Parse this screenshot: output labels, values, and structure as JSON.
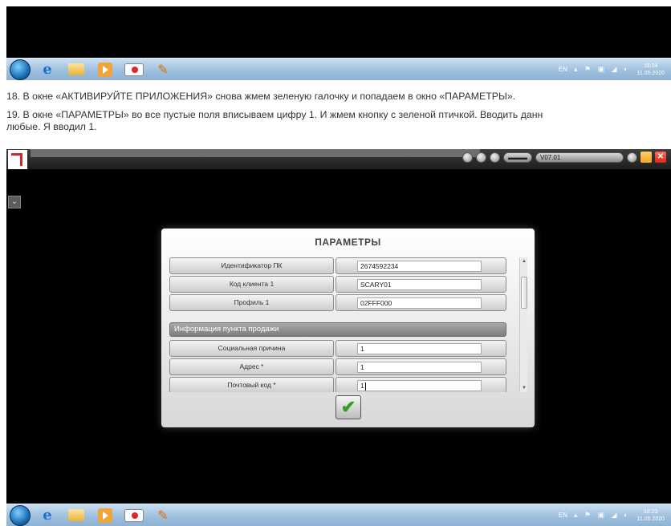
{
  "taskbar_top": {
    "tray": {
      "lang": "EN",
      "time": "18:04",
      "date": "11.05.2020"
    }
  },
  "instructions": {
    "step18": "18. В окне «АКТИВИРУЙТЕ ПРИЛОЖЕНИЯ» снова жмем зеленую галочку и попадаем в окно «ПАРАМЕТРЫ».",
    "step19_line1": "19. В окне «ПАРАМЕТРЫ» во все пустые поля вписываем цифру 1. И жмем кнопку с зеленой птичкой. Вводить данн",
    "step19_line2": "любые. Я вводил 1."
  },
  "app": {
    "version": "V07.01",
    "dialog": {
      "title": "ПАРАМЕТРЫ",
      "rows_top": [
        {
          "label": "Идентификатор ПК",
          "value": "2674592234"
        },
        {
          "label": "Код клиента 1",
          "value": "SCARY01"
        },
        {
          "label": "Профиль 1",
          "value": "02FFF000"
        }
      ],
      "section_title": "Информация пункта продажи",
      "rows_bottom": [
        {
          "label": "Социальная причина",
          "value": "1"
        },
        {
          "label": "Адрес *",
          "value": "1"
        },
        {
          "label": "Почтовый код *",
          "value": "1"
        }
      ]
    }
  },
  "taskbar_bottom": {
    "tray": {
      "lang": "EN",
      "time": "18:23",
      "date": "11.05.2020"
    }
  },
  "colors": {
    "ok_check": "#2f9e21",
    "logo_red": "#d8232a",
    "taskbar": "#9fc0de"
  },
  "icons": [
    "windows-start-icon",
    "internet-explorer-icon",
    "folder-icon",
    "media-player-icon",
    "recorder-icon",
    "paint-icon",
    "checkmark-icon"
  ]
}
